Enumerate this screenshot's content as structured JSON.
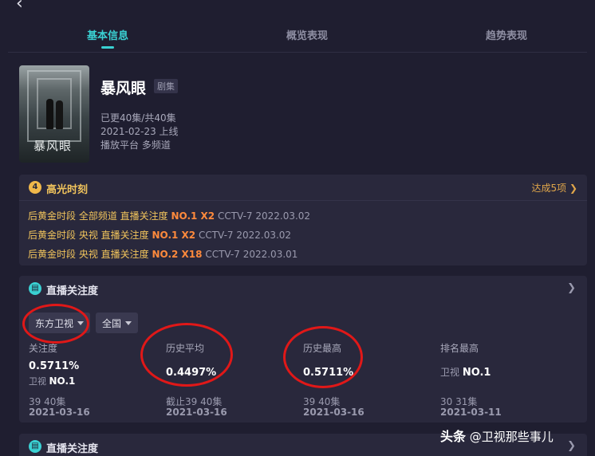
{
  "nav": {
    "back_icon": "back-arrow-icon",
    "tabs": [
      {
        "label": "基本信息",
        "active": true
      },
      {
        "label": "概览表现",
        "active": false
      },
      {
        "label": "趋势表现",
        "active": false
      }
    ]
  },
  "show": {
    "poster_title": "暴风眼",
    "title": "暴风眼",
    "type_badge": "剧集",
    "episodes": "已更40集/共40集",
    "release": "2021-02-23 上线",
    "platform": "播放平台 多频道"
  },
  "highlights": {
    "badge_number": "4",
    "title": "高光时刻",
    "more_label": "达成5项",
    "rows": [
      {
        "prefix": "后黄金时段 全部频道 直播关注度",
        "rank": "NO.1 X2",
        "suffix": "CCTV-7 2022.03.02"
      },
      {
        "prefix": "后黄金时段 央视 直播关注度",
        "rank": "NO.1 X2",
        "suffix": "CCTV-7 2022.03.02"
      },
      {
        "prefix": "后黄金时段 央视 直播关注度",
        "rank": "NO.2 X18",
        "suffix": "CCTV-7 2022.03.01"
      }
    ]
  },
  "attention": {
    "title": "直播关注度",
    "channel_select": "东方卫视",
    "region_select": "全国",
    "cols": [
      {
        "label": "关注度",
        "value": "0.5711%",
        "sub_label": "卫视",
        "sub_value": "NO.1",
        "episode": "39 40集",
        "date": "2021-03-16"
      },
      {
        "label": "历史平均",
        "value": "0.4497%",
        "episode": "截止39 40集",
        "date": "2021-03-16"
      },
      {
        "label": "历史最高",
        "value": "0.5711%",
        "episode": "39 40集",
        "date": "2021-03-16"
      },
      {
        "label": "排名最高",
        "sub_label": "卫视",
        "sub_value": "NO.1",
        "episode": "30 31集",
        "date": "2021-03-11"
      }
    ]
  },
  "attention2": {
    "title": "直播关注度"
  },
  "watermark": {
    "prefix": "头条",
    "handle": "@卫视那些事儿"
  },
  "colors": {
    "accent": "#3ad1d3",
    "highlight_orange": "#ff8a3c",
    "highlight_gold": "#f0c35c",
    "annotation_red": "#e01818"
  }
}
